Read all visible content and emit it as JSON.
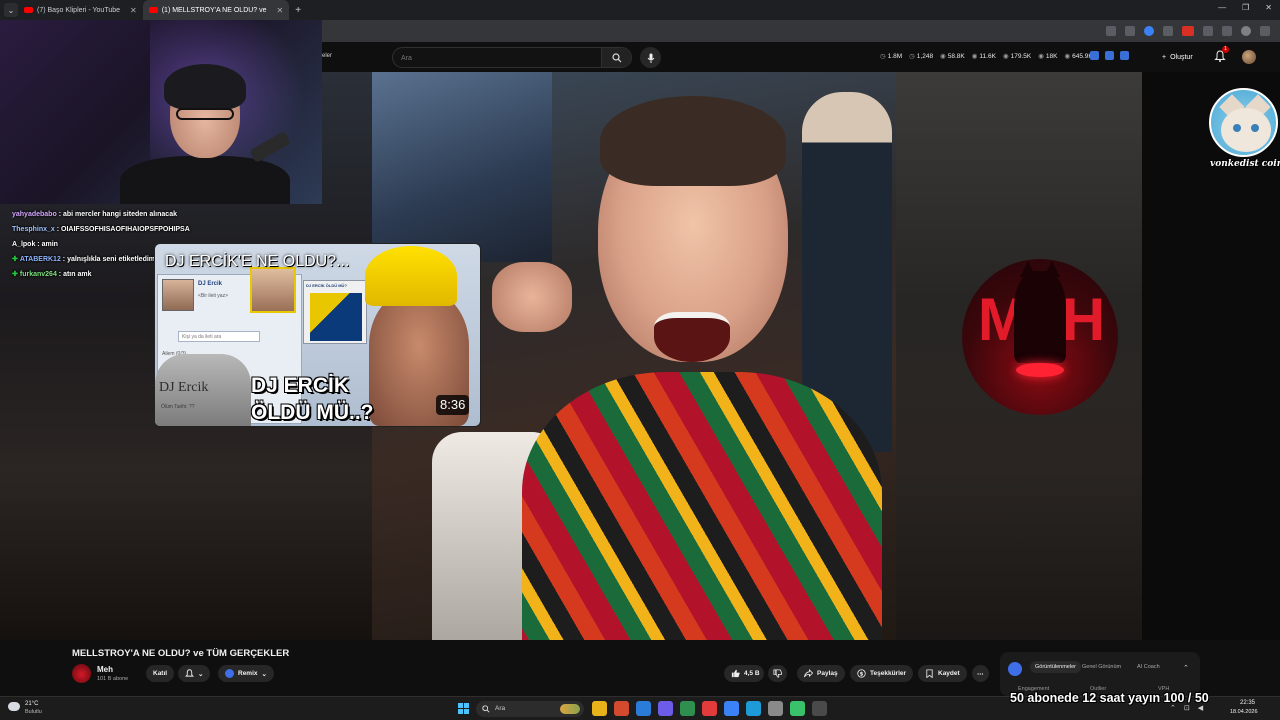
{
  "browser": {
    "tabs": [
      {
        "label": "(7) Başo Klipleri - YouTube",
        "active": false
      },
      {
        "label": "(1) MELLSTROY'A NE OLDU? ve",
        "active": true
      }
    ],
    "new_tab_label": "+",
    "tab_menu_label": "⌄",
    "window_controls": [
      "—",
      "❐",
      "✕"
    ]
  },
  "youtube_header": {
    "filters_label": "reler",
    "search_placeholder": "Ara",
    "stats": [
      {
        "icon": "clock-icon",
        "value": "1.8M"
      },
      {
        "icon": "thumb-icon",
        "value": "1,248"
      },
      {
        "icon": "eye-icon",
        "value": "58.8K"
      },
      {
        "icon": "user-icon",
        "value": "11.6K"
      },
      {
        "icon": "eye-icon",
        "value": "179.5K"
      },
      {
        "icon": "user-icon",
        "value": "18K"
      },
      {
        "icon": "eye-icon",
        "value": "645.9K"
      }
    ],
    "create_label": "Oluştur",
    "notification_count": "1"
  },
  "chat": [
    {
      "user": "yahyadebabo",
      "user_color": "#d4a8ff",
      "badge": false,
      "message": "abi mercler hangi siteden alınacak"
    },
    {
      "user": "Thesphinx_x",
      "user_color": "#9fc3ff",
      "badge": false,
      "message": "OIAIFSSOFHISAOFIHAIOPSFPOHIPSA"
    },
    {
      "user": "A_lpok",
      "user_color": "#ffffff",
      "badge": false,
      "message": "amin"
    },
    {
      "user": "ATABERK12",
      "user_color": "#8fb4ff",
      "badge": true,
      "message": "yalnışlıkla seni etiketledim"
    },
    {
      "user": "furkanv264",
      "user_color": "#7fe07f",
      "badge": true,
      "message": "atın amk"
    }
  ],
  "chat_separator": " : ",
  "chat_badge_glyph": "✚",
  "thumbnail": {
    "title": "DJ ERCİK'E NE OLDU?...",
    "msn_name": "DJ Ercik",
    "msn_sub": "<Bir ileti yaz>",
    "msn_placeholder": "Kişi ya da ileti ara",
    "msn_row": "Ailem (0/3)",
    "tomb_name": "DJ Ercik",
    "tomb_date": "Ölüm Tarihi: ??",
    "window_title": "DJ ERCİK ÖLDÜ MÜ?",
    "big_line1": "DJ ERCİK",
    "big_line2": "ÖLDÜ MÜ..?",
    "duration": "8:36"
  },
  "overlays": {
    "cat_name": "vonkedist coin",
    "meh_letters": "MEH",
    "subscriber_goal": "50 abonede 12 saat yayın 100 / 50"
  },
  "video": {
    "title": "MELLSTROY'A NE OLDU? ve TÜM GERÇEKLER",
    "channel": "Meh",
    "subscribers": "101 B abone",
    "join_label": "Katıl",
    "remix_label": "Remix",
    "likes": "4,5 B",
    "share_label": "Paylaş",
    "thanks_label": "Teşekkürler",
    "save_label": "Kaydet",
    "more_label": "⋯"
  },
  "analytics_panel": {
    "tabs": [
      "Görüntülenmeler",
      "Genel Görünüm",
      "AI Coach"
    ],
    "active_tab": 0,
    "sub_labels": [
      "Engagement",
      "Outlier",
      "VPH"
    ],
    "chevron": "⌃"
  },
  "taskbar": {
    "temperature": "21°C",
    "condition": "Bulutlu",
    "search_label": "Ara",
    "time": "22:35",
    "date": "18.04.2026",
    "app_colors": [
      "#e8b21b",
      "#d34b2f",
      "#2b7bd8",
      "#6c5ce7",
      "#2f8f4f",
      "#e23b3b",
      "#3b82f6",
      "#1e9bd7",
      "#8a8a8a",
      "#3ac16b",
      "#4a4a4a"
    ]
  },
  "colors": {
    "yt_red": "#ff0000",
    "remix_blue": "#3e6ee8",
    "accent_chat_badge": "#27c93f"
  }
}
